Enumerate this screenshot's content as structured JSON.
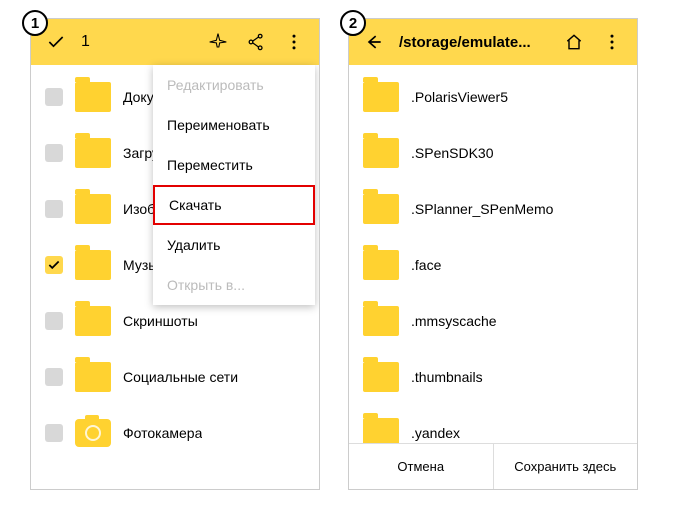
{
  "badges": {
    "one": "1",
    "two": "2"
  },
  "screen1": {
    "selection_count": "1",
    "files": [
      {
        "name": "Документы",
        "checked": false,
        "icon": "folder"
      },
      {
        "name": "Загрузки",
        "checked": false,
        "icon": "folder"
      },
      {
        "name": "Изображения",
        "checked": false,
        "icon": "folder"
      },
      {
        "name": "Музыка",
        "checked": true,
        "icon": "folder"
      },
      {
        "name": "Скриншоты",
        "checked": false,
        "icon": "folder"
      },
      {
        "name": "Социальные сети",
        "checked": false,
        "icon": "folder"
      },
      {
        "name": "Фотокамера",
        "checked": false,
        "icon": "camera"
      }
    ],
    "menu": {
      "edit": "Редактировать",
      "rename": "Переименовать",
      "move": "Переместить",
      "download": "Скачать",
      "delete": "Удалить",
      "open_in": "Открыть в..."
    }
  },
  "screen2": {
    "path": "/storage/emulate...",
    "files": [
      {
        "name": ".PolarisViewer5"
      },
      {
        "name": ".SPenSDK30"
      },
      {
        "name": ".SPlanner_SPenMemo"
      },
      {
        "name": ".face"
      },
      {
        "name": ".mmsyscache"
      },
      {
        "name": ".thumbnails"
      },
      {
        "name": ".yandex"
      }
    ],
    "cancel": "Отмена",
    "save_here": "Сохранить здесь"
  }
}
